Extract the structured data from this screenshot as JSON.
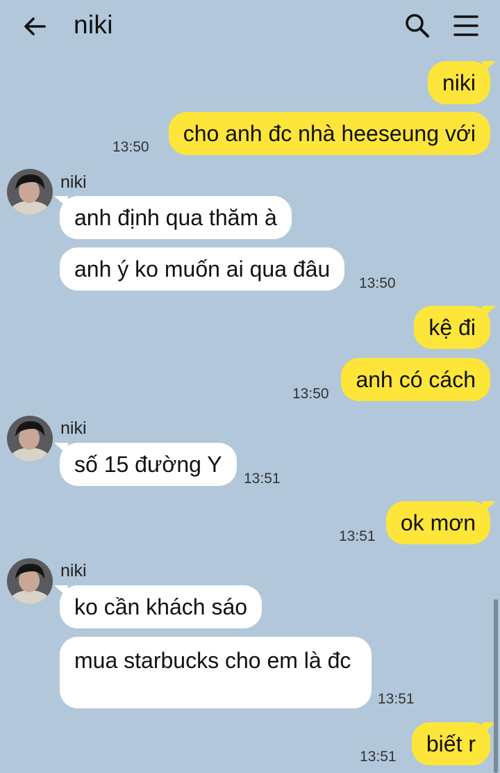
{
  "header": {
    "title": "niki",
    "back_icon": "arrow-left-icon",
    "search_icon": "search-icon",
    "menu_icon": "hamburger-menu-icon"
  },
  "colors": {
    "background": "#b2c7da",
    "outgoing_bubble": "#fde53a",
    "incoming_bubble": "#ffffff"
  },
  "messages": [
    {
      "from": "me",
      "text": "niki",
      "time": ""
    },
    {
      "from": "me",
      "text": "cho anh đc nhà heeseung với",
      "time": "13:50"
    },
    {
      "from": "niki",
      "sender": "niki",
      "text": "anh định qua thăm à",
      "time": ""
    },
    {
      "from": "niki",
      "text": "anh ý ko muốn ai qua đâu",
      "time": "13:50"
    },
    {
      "from": "me",
      "text": "kệ đi",
      "time": ""
    },
    {
      "from": "me",
      "text": "anh có cách",
      "time": "13:50"
    },
    {
      "from": "niki",
      "sender": "niki",
      "text": "số 15 đường Y",
      "time": "13:51"
    },
    {
      "from": "me",
      "text": "ok mơn",
      "time": "13:51"
    },
    {
      "from": "niki",
      "sender": "niki",
      "text": "ko cần khách sáo",
      "time": ""
    },
    {
      "from": "niki",
      "text": "mua starbucks cho em là đc",
      "time": "13:51"
    },
    {
      "from": "me",
      "text": "biết r",
      "time": "13:51"
    }
  ]
}
